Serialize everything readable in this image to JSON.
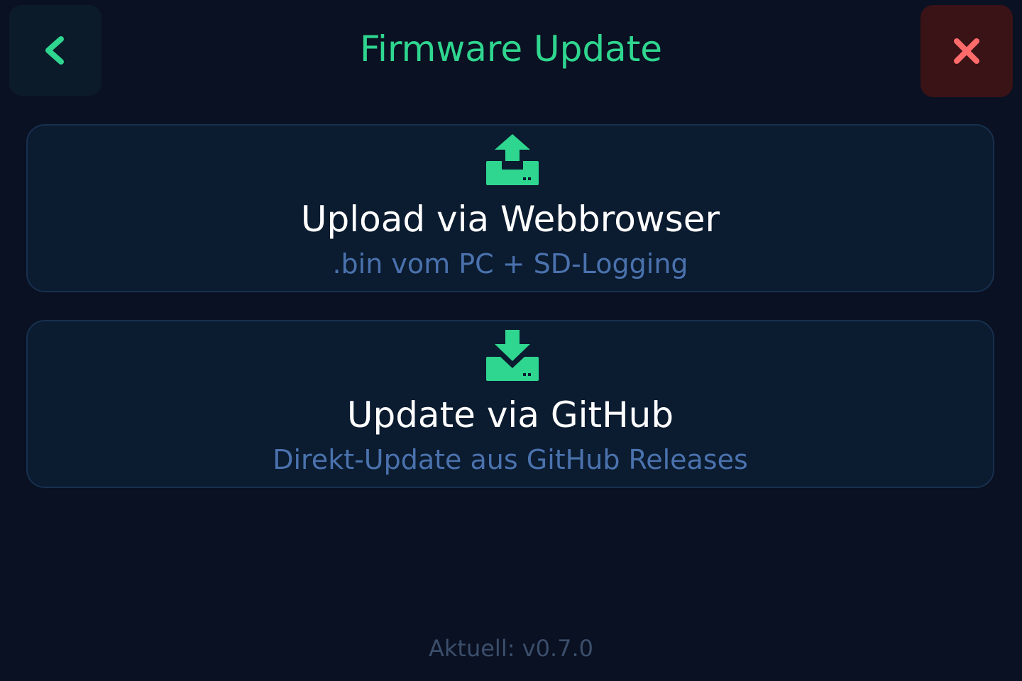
{
  "header": {
    "title": "Firmware Update",
    "back_icon": "chevron-left-icon",
    "close_icon": "close-icon"
  },
  "options": [
    {
      "title": "Upload via Webbrowser",
      "subtitle": ".bin vom PC + SD-Logging",
      "icon": "upload-icon"
    },
    {
      "title": "Update via GitHub",
      "subtitle": "Direkt-Update aus GitHub Releases",
      "icon": "download-icon"
    }
  ],
  "footer": {
    "version": "Aktuell: v0.7.0"
  },
  "colors": {
    "background": "#0a1122",
    "accent": "#2fd68f",
    "close_accent": "#ff6b6b",
    "close_background": "#3a1316",
    "card_background": "#0b1b30",
    "card_border": "#17304d",
    "subtitle": "#4a72ad",
    "muted": "#3b4e6b"
  }
}
